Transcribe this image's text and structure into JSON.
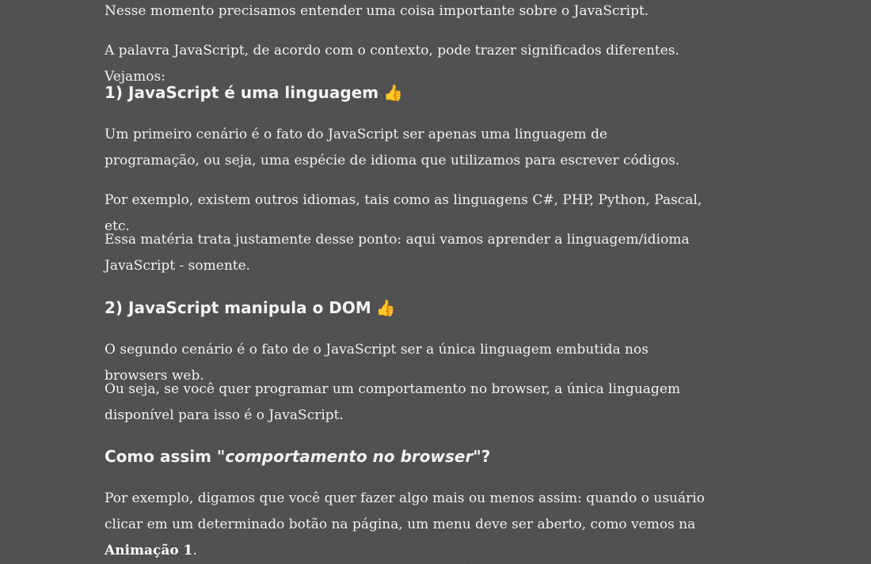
{
  "article": {
    "p_intro_1": "Nesse momento precisamos entender uma coisa importante sobre o JavaScript.",
    "p_intro_2": "A palavra JavaScript, de acordo com o contexto, pode trazer significados diferentes. Vejamos:",
    "section_1": {
      "heading": "1) JavaScript é uma linguagem",
      "icon": "thumbs-up-icon",
      "p1": "Um primeiro cenário é o fato do JavaScript ser apenas uma linguagem de programação, ou seja, uma espécie de idioma que utilizamos para escrever códigos.",
      "p2": "Por exemplo, existem outros idiomas, tais como as linguagens C#, PHP, Python, Pascal, etc.",
      "p3": "Essa matéria trata justamente desse ponto: aqui vamos aprender a linguagem/idioma JavaScript - somente."
    },
    "section_2": {
      "heading": "2) JavaScript manipula o DOM",
      "icon": "thumbs-up-icon",
      "p1": "O segundo cenário é o fato de o JavaScript ser a única linguagem embutida nos browsers web.",
      "p2": "Ou seja, se você quer programar um comportamento no browser, a única linguagem disponível para isso é o JavaScript."
    },
    "section_3": {
      "heading_prefix": "Como assim \"",
      "heading_em": "comportamento no browser",
      "heading_suffix": "\"?",
      "p1_text": "Por exemplo, digamos que você quer fazer algo mais ou menos assim: quando o usuário clicar em um determinado botão na página, um menu deve ser aberto, como vemos na ",
      "p1_bold": "Animação 1",
      "p1_end": "."
    },
    "thumb_glyph": "👍"
  }
}
